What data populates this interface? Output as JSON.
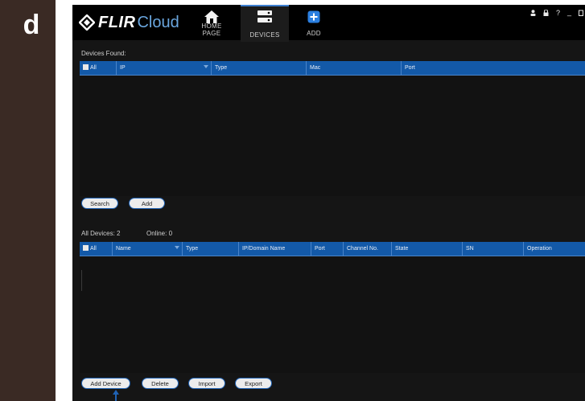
{
  "figure_label": "d",
  "app": {
    "brand_flir": "FLIR",
    "brand_cloud": "Cloud",
    "accent_color": "#1359a8"
  },
  "nav": {
    "home": "HOME PAGE",
    "devices": "DEVICES",
    "add": "ADD"
  },
  "tray_icons": [
    "user-icon",
    "lock-icon",
    "help-icon",
    "minimize-icon",
    "maximize-icon"
  ],
  "tray_glyphs": {
    "help": "?",
    "minimize": "_"
  },
  "found": {
    "label": "Devices Found:",
    "columns": [
      "All",
      "IP",
      "Type",
      "Mac",
      "Port"
    ],
    "search_btn": "Search",
    "add_btn": "Add"
  },
  "all_devices": {
    "label": "All Devices: 2",
    "online": "Online: 0",
    "columns": [
      "All",
      "Name",
      "Type",
      "IP/Domain Name",
      "Port",
      "Channel No.",
      "State",
      "SN",
      "Operation"
    ],
    "add_device_btn": "Add Device",
    "delete_btn": "Delete",
    "import_btn": "Import",
    "export_btn": "Export"
  }
}
